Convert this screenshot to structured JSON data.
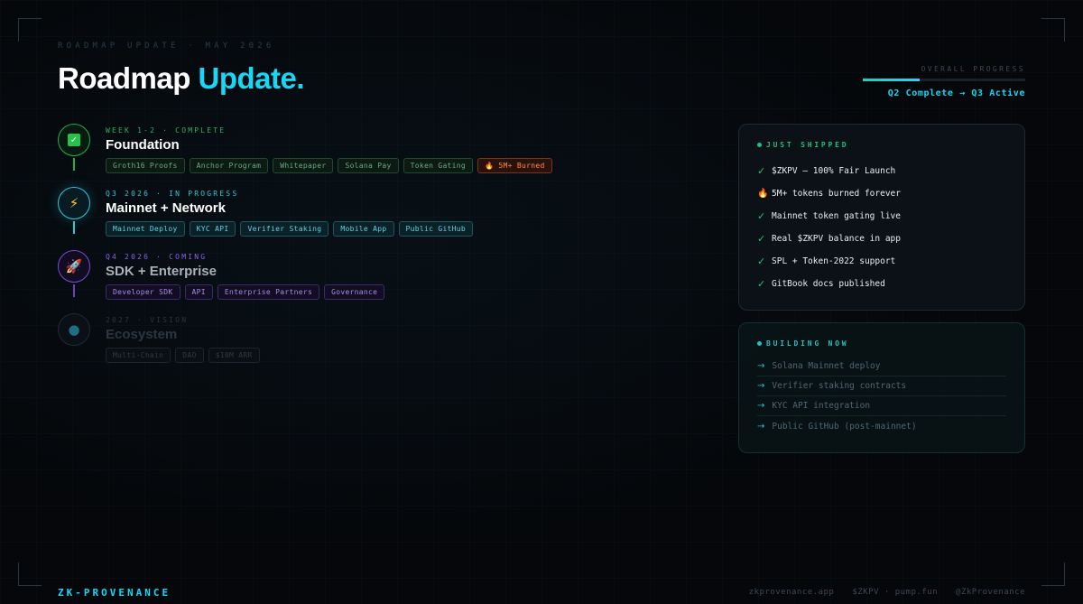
{
  "header": {
    "eyebrow": "ROADMAP UPDATE · MAY 2026",
    "title_main": "Roadmap",
    "title_accent": "Update."
  },
  "progress": {
    "label": "OVERALL PROGRESS",
    "status": "Q2 Complete → Q3 Active",
    "fraction": 0.35
  },
  "timeline": [
    {
      "tag": "WEEK 1-2 · COMPLETE",
      "name": "Foundation",
      "icon": "check-icon",
      "chips": [
        "Groth16 Proofs",
        "Anchor Program",
        "Whitepaper",
        "Solana Pay",
        "Token Gating",
        "🔥 5M+ Burned"
      ]
    },
    {
      "tag": "Q3 2026 · IN PROGRESS",
      "name": "Mainnet + Network",
      "icon": "lightning-icon",
      "chips": [
        "Mainnet Deploy",
        "KYC API",
        "Verifier Staking",
        "Mobile App",
        "Public GitHub"
      ]
    },
    {
      "tag": "Q4 2026 · COMING",
      "name": "SDK + Enterprise",
      "icon": "rocket-icon",
      "chips": [
        "Developer SDK",
        "API",
        "Enterprise Partners",
        "Governance"
      ]
    },
    {
      "tag": "2027 · VISION",
      "name": "Ecosystem",
      "icon": "globe-icon",
      "chips": [
        "Multi-Chain",
        "DAO",
        "$10M ARR"
      ]
    }
  ],
  "shipped": {
    "title": "JUST SHIPPED",
    "items": [
      "$ZKPV — 100% Fair Launch",
      "5M+ tokens burned forever",
      "Mainnet token gating live",
      "Real $ZKPV balance in app",
      "SPL + Token-2022 support",
      "GitBook docs published"
    ]
  },
  "building": {
    "title": "BUILDING NOW",
    "items": [
      "Solana Mainnet deploy",
      "Verifier staking contracts",
      "KYC API integration",
      "Public GitHub (post-mainnet)"
    ]
  },
  "footer": {
    "brand": "ZK-PROVENANCE",
    "links": [
      "zkprovenance.app",
      "$ZKPV · pump.fun",
      "@ZkProvenance"
    ]
  },
  "colors": {
    "accent": "#19d6f5",
    "complete": "#22b04c",
    "in_progress": "#2bc8d8",
    "coming": "#7a4ad6",
    "vision": "#2a3540"
  }
}
